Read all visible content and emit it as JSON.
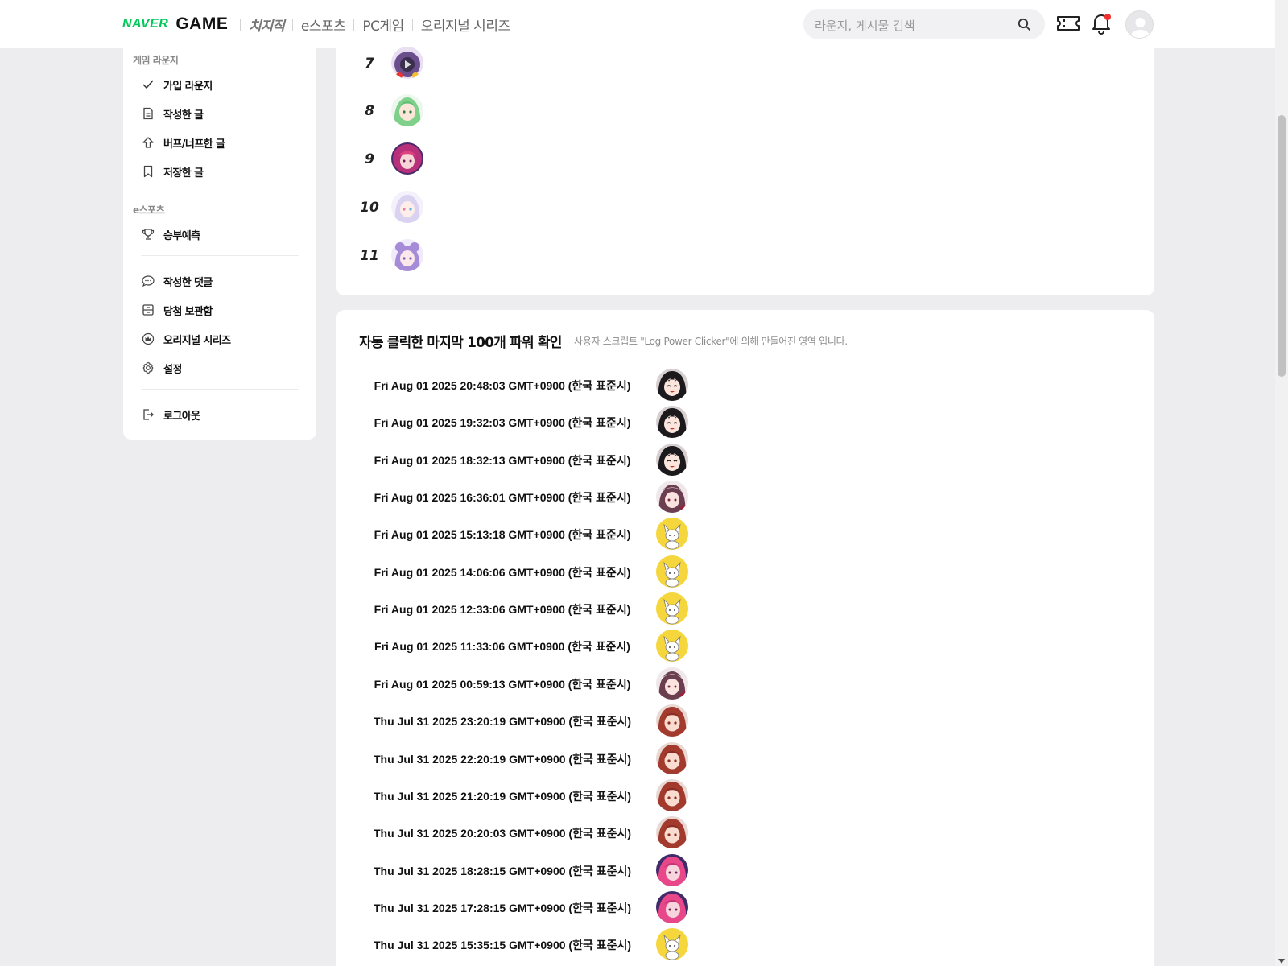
{
  "header": {
    "logo_naver": "NAVER",
    "logo_game": "GAME",
    "nav": [
      "치지직",
      "e스포츠",
      "PC게임",
      "오리지널 시리즈"
    ],
    "search_placeholder": "라운지, 게시물 검색"
  },
  "sidebar": {
    "section_lounge": "게임 라운지",
    "lounge_items": [
      {
        "label": "가입 라운지",
        "icon": "check-icon"
      },
      {
        "label": "작성한 글",
        "icon": "document-icon"
      },
      {
        "label": "버프/너프한 글",
        "icon": "arrow-up-icon"
      },
      {
        "label": "저장한 글",
        "icon": "bookmark-icon"
      }
    ],
    "section_esports": "e스포츠",
    "esports_items": [
      {
        "label": "승부예측",
        "icon": "trophy-icon"
      }
    ],
    "misc_items": [
      {
        "label": "작성한 댓글",
        "icon": "comment-icon"
      },
      {
        "label": "당첨 보관함",
        "icon": "archive-icon"
      },
      {
        "label": "오리지널 시리즈",
        "icon": "crown-icon"
      },
      {
        "label": "설정",
        "icon": "gear-icon"
      }
    ],
    "logout": {
      "label": "로그아웃",
      "icon": "logout-icon"
    }
  },
  "ranking": {
    "rows": [
      {
        "rank": "7",
        "avatar_color": "#6b4e8c"
      },
      {
        "rank": "8",
        "avatar_color": "#7ed08a"
      },
      {
        "rank": "9",
        "avatar_color": "#b8307a"
      },
      {
        "rank": "10",
        "avatar_color": "#d9d2f0"
      },
      {
        "rank": "11",
        "avatar_color": "#a68bd8"
      }
    ]
  },
  "log": {
    "title": "자동 클릭한 마지막 100개 파워 확인",
    "subtitle": "사용자 스크립트 \"Log Power Clicker\"에 의해 만들어진 영역 입니다.",
    "entries": [
      {
        "time": "Fri Aug 01 2025 20:48:03 GMT+0900 (한국 표준시)",
        "avatar": "dark-hair"
      },
      {
        "time": "Fri Aug 01 2025 19:32:03 GMT+0900 (한국 표준시)",
        "avatar": "dark-hair"
      },
      {
        "time": "Fri Aug 01 2025 18:32:13 GMT+0900 (한국 표준시)",
        "avatar": "dark-hair"
      },
      {
        "time": "Fri Aug 01 2025 16:36:01 GMT+0900 (한국 표준시)",
        "avatar": "white-cap"
      },
      {
        "time": "Fri Aug 01 2025 15:13:18 GMT+0900 (한국 표준시)",
        "avatar": "yellow-cat"
      },
      {
        "time": "Fri Aug 01 2025 14:06:06 GMT+0900 (한국 표준시)",
        "avatar": "yellow-cat"
      },
      {
        "time": "Fri Aug 01 2025 12:33:06 GMT+0900 (한국 표준시)",
        "avatar": "yellow-cat"
      },
      {
        "time": "Fri Aug 01 2025 11:33:06 GMT+0900 (한국 표준시)",
        "avatar": "yellow-cat"
      },
      {
        "time": "Fri Aug 01 2025 00:59:13 GMT+0900 (한국 표준시)",
        "avatar": "white-cap"
      },
      {
        "time": "Thu Jul 31 2025 23:20:19 GMT+0900 (한국 표준시)",
        "avatar": "red-hair"
      },
      {
        "time": "Thu Jul 31 2025 22:20:19 GMT+0900 (한국 표준시)",
        "avatar": "red-hair"
      },
      {
        "time": "Thu Jul 31 2025 21:20:19 GMT+0900 (한국 표준시)",
        "avatar": "red-hair"
      },
      {
        "time": "Thu Jul 31 2025 20:20:03 GMT+0900 (한국 표준시)",
        "avatar": "red-hair"
      },
      {
        "time": "Thu Jul 31 2025 18:28:15 GMT+0900 (한국 표준시)",
        "avatar": "pink-hair"
      },
      {
        "time": "Thu Jul 31 2025 17:28:15 GMT+0900 (한국 표준시)",
        "avatar": "pink-hair"
      },
      {
        "time": "Thu Jul 31 2025 15:35:15 GMT+0900 (한국 표준시)",
        "avatar": "yellow-cat"
      }
    ]
  }
}
